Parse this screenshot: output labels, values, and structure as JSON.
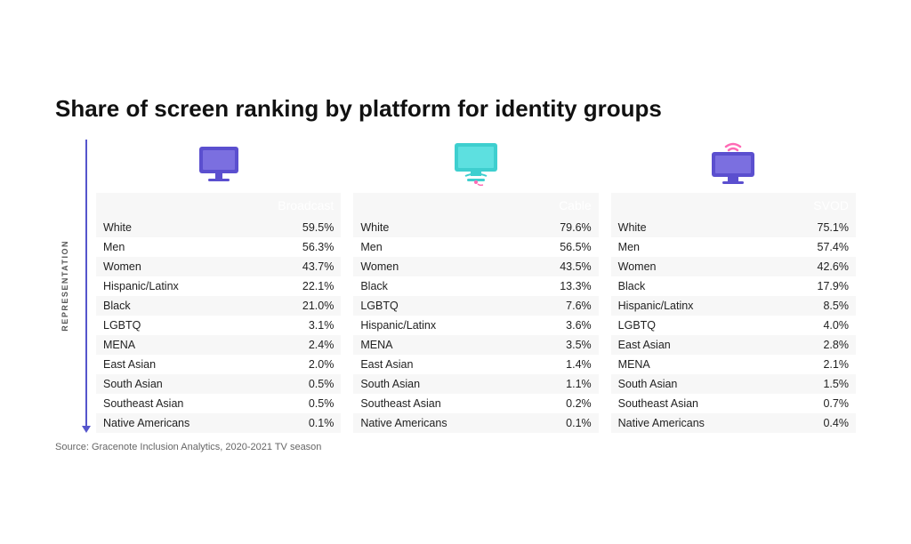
{
  "title": "Share of screen ranking by platform for identity groups",
  "source": "Source: Gracenote Inclusion Analytics, 2020-2021 TV season",
  "left_label": "REPRESENTATION",
  "platforms": [
    {
      "name": "Broadcast",
      "icon_type": "broadcast",
      "rows": [
        [
          "White",
          "59.5%"
        ],
        [
          "Men",
          "56.3%"
        ],
        [
          "Women",
          "43.7%"
        ],
        [
          "Hispanic/Latinx",
          "22.1%"
        ],
        [
          "Black",
          "21.0%"
        ],
        [
          "LGBTQ",
          "3.1%"
        ],
        [
          "MENA",
          "2.4%"
        ],
        [
          "East Asian",
          "2.0%"
        ],
        [
          "South Asian",
          "0.5%"
        ],
        [
          "Southeast Asian",
          "0.5%"
        ],
        [
          "Native Americans",
          "0.1%"
        ]
      ]
    },
    {
      "name": "Cable",
      "icon_type": "cable",
      "rows": [
        [
          "White",
          "79.6%"
        ],
        [
          "Men",
          "56.5%"
        ],
        [
          "Women",
          "43.5%"
        ],
        [
          "Black",
          "13.3%"
        ],
        [
          "LGBTQ",
          "7.6%"
        ],
        [
          "Hispanic/Latinx",
          "3.6%"
        ],
        [
          "MENA",
          "3.5%"
        ],
        [
          "East Asian",
          "1.4%"
        ],
        [
          "South Asian",
          "1.1%"
        ],
        [
          "Southeast Asian",
          "0.2%"
        ],
        [
          "Native Americans",
          "0.1%"
        ]
      ]
    },
    {
      "name": "SVOD",
      "icon_type": "svod",
      "rows": [
        [
          "White",
          "75.1%"
        ],
        [
          "Men",
          "57.4%"
        ],
        [
          "Women",
          "42.6%"
        ],
        [
          "Black",
          "17.9%"
        ],
        [
          "Hispanic/Latinx",
          "8.5%"
        ],
        [
          "LGBTQ",
          "4.0%"
        ],
        [
          "East Asian",
          "2.8%"
        ],
        [
          "MENA",
          "2.1%"
        ],
        [
          "South Asian",
          "1.5%"
        ],
        [
          "Southeast Asian",
          "0.7%"
        ],
        [
          "Native Americans",
          "0.4%"
        ]
      ]
    }
  ]
}
